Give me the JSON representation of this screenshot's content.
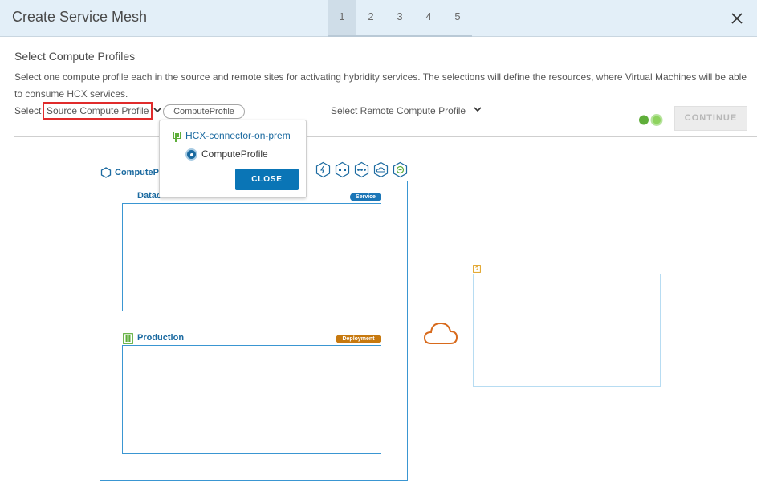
{
  "header": {
    "title": "Create Service Mesh",
    "steps": [
      "1",
      "2",
      "3",
      "4",
      "5"
    ],
    "active_step": "1",
    "close_icon": "close-icon"
  },
  "main": {
    "section_title": "Select Compute Profiles",
    "description": "Select one compute profile each in the source and remote sites for activating hybridity services. The selections will define the resources, where Virtual Machines will be able to consume HCX services.",
    "select_prefix": "Select",
    "source_selector_label": "Source Compute Profile",
    "selected_source_pill": "ComputeProfile",
    "remote_selector_label": "Select Remote Compute Profile",
    "continue_label": "CONTINUE"
  },
  "diagram": {
    "compute_profile_label": "ComputePr",
    "datacenter_label": "Datac",
    "service_badge": "Service",
    "production_label": "Production",
    "deployment_badge": "Deployment",
    "service_icons": [
      "vmotion-icon",
      "network-extension-icon",
      "wan-optimization-icon",
      "cloud-service-icon",
      "migration-icon"
    ]
  },
  "popover": {
    "site_name": "HCX-connector-on-prem",
    "option_label": "ComputeProfile",
    "close_label": "CLOSE"
  },
  "colors": {
    "header_bg": "#e3eff8",
    "accent_blue": "#1b6aa0",
    "primary_button": "#0a75b6",
    "highlight_red": "#e02b2b",
    "deployment_orange": "#c7790f",
    "cloud_orange": "#d86a1c",
    "toggle_green": "#5fae3a"
  }
}
